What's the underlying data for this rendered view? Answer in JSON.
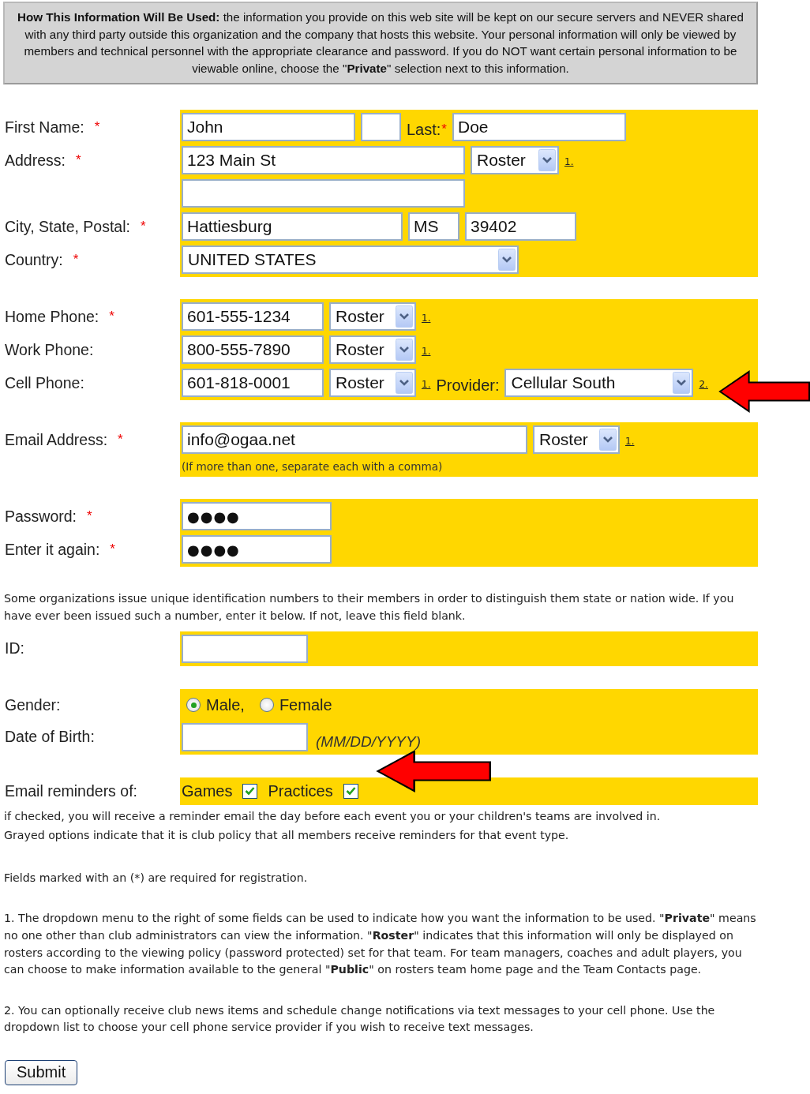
{
  "notice": "**How This Information Will Be Used:** the information you provide on this web site will be kept on our secure servers and NEVER shared with any third party outside this organization and the company that hosts this website. Your personal information will only be viewed by members and technical personnel with the appropriate clearance and password. If you do NOT want certain personal information to be viewable online, choose the \"**Private**\" selection next to this information.",
  "blocks": [
    {
      "kind": "section",
      "rows": [
        {
          "label": "First Name:",
          "mark": "*",
          "controls": [
            {
              "kind": "input",
              "value": "John"
            },
            {
              "kind": "input"
            },
            {
              "kind": "text",
              "text": "Last:",
              "mark": "*"
            },
            {
              "kind": "input",
              "value": "Doe"
            }
          ]
        },
        {
          "label": "Address:",
          "mark": "*",
          "controls": [
            {
              "kind": "input",
              "value": "123 Main St"
            },
            {
              "kind": "select",
              "value": "Roster"
            },
            {
              "kind": "footnote",
              "text": "1."
            }
          ]
        },
        {
          "controls": [
            {
              "kind": "input"
            }
          ]
        },
        {
          "label": "City, State, Postal:",
          "mark": "*",
          "controls": [
            {
              "kind": "input",
              "value": "Hattiesburg"
            },
            {
              "kind": "input",
              "value": "MS"
            },
            {
              "kind": "input",
              "value": "39402"
            }
          ]
        },
        {
          "label": "Country:",
          "mark": "*",
          "controls": [
            {
              "kind": "select",
              "value": "UNITED STATES"
            }
          ]
        }
      ]
    },
    {
      "kind": "section",
      "rows": [
        {
          "label": "Home Phone:",
          "mark": "*",
          "controls": [
            {
              "kind": "input",
              "value": "601-555-1234"
            },
            {
              "kind": "select",
              "value": "Roster"
            },
            {
              "kind": "footnote",
              "text": "1."
            }
          ]
        },
        {
          "label": "Work Phone:",
          "controls": [
            {
              "kind": "input",
              "value": "800-555-7890"
            },
            {
              "kind": "select",
              "value": "Roster"
            },
            {
              "kind": "footnote",
              "text": "1."
            }
          ]
        },
        {
          "label": "Cell Phone:",
          "controls": [
            {
              "kind": "input",
              "value": "601-818-0001"
            },
            {
              "kind": "select",
              "value": "Roster"
            },
            {
              "kind": "footnote",
              "text": "1."
            },
            {
              "kind": "text",
              "text": "Provider:"
            },
            {
              "kind": "select",
              "value": "Cellular South"
            },
            {
              "kind": "footnote",
              "text": "2."
            }
          ]
        }
      ]
    },
    {
      "kind": "section",
      "rows": [
        {
          "label": "Email Address:",
          "mark": "*",
          "controls": [
            {
              "kind": "input",
              "value": "info@ogaa.net"
            },
            {
              "kind": "select",
              "value": "Roster"
            },
            {
              "kind": "footnote",
              "text": "1."
            }
          ]
        },
        {
          "controls": [
            {
              "kind": "note",
              "text": "(If more than one, separate each with a comma)"
            }
          ]
        }
      ]
    },
    {
      "kind": "section",
      "rows": [
        {
          "label": "Password:",
          "mark": "*",
          "controls": [
            {
              "kind": "password",
              "value": "●●●●"
            }
          ]
        },
        {
          "label": "Enter it again:",
          "mark": "*",
          "controls": [
            {
              "kind": "password",
              "value": "●●●●"
            }
          ]
        }
      ]
    },
    {
      "kind": "paragraph",
      "text": "Some organizations issue unique identification numbers to their members in order to distinguish them state or nation wide.  If you have ever been issued such a number, enter it below.  If not, leave this field blank."
    },
    {
      "kind": "section",
      "rows": [
        {
          "label": "ID:",
          "controls": [
            {
              "kind": "input"
            }
          ]
        }
      ]
    },
    {
      "kind": "section",
      "rows": [
        {
          "label": "Gender:",
          "controls": [
            {
              "kind": "radio",
              "text": "Male,",
              "selected": true
            },
            {
              "kind": "radio",
              "text": "Female",
              "selected": false
            }
          ]
        },
        {
          "label": "Date of Birth:",
          "controls": [
            {
              "kind": "input"
            },
            {
              "kind": "hint",
              "text": "(MM/DD/YYYY)"
            }
          ]
        }
      ]
    },
    {
      "kind": "section",
      "rows": [
        {
          "label": "Email reminders of:",
          "controls": [
            {
              "kind": "checkbox",
              "text": "Games",
              "checked": true
            },
            {
              "kind": "checkbox",
              "text": "Practices",
              "checked": true
            }
          ]
        }
      ]
    },
    {
      "kind": "paragraph",
      "text": "if checked, you will receive a reminder email the day before each event you or your children's teams are involved in."
    },
    {
      "kind": "paragraph",
      "text": "Grayed options indicate that it is club policy that all members receive reminders for that event type."
    },
    {
      "kind": "paragraph",
      "text": "Fields marked with an (*) are required for registration."
    },
    {
      "kind": "paragraph",
      "text": "1. The dropdown menu to the right of some fields can be used to indicate how you want the information to be used. \"**Private**\" means no one other than club administrators can view the information.  \"**Roster**\" indicates that this information will only be displayed on rosters according to the viewing policy (password protected) set for that team.  For team managers, coaches and adult players, you can choose to make information available to the general \"**Public**\" on rosters team home page and the Team Contacts page."
    },
    {
      "kind": "paragraph",
      "text": "2. You can optionally receive club news items and schedule change notifications via text messages to your cell phone. Use the dropdown list to choose your cell phone service provider if you wish to receive text messages."
    }
  ],
  "submit": "Submit"
}
